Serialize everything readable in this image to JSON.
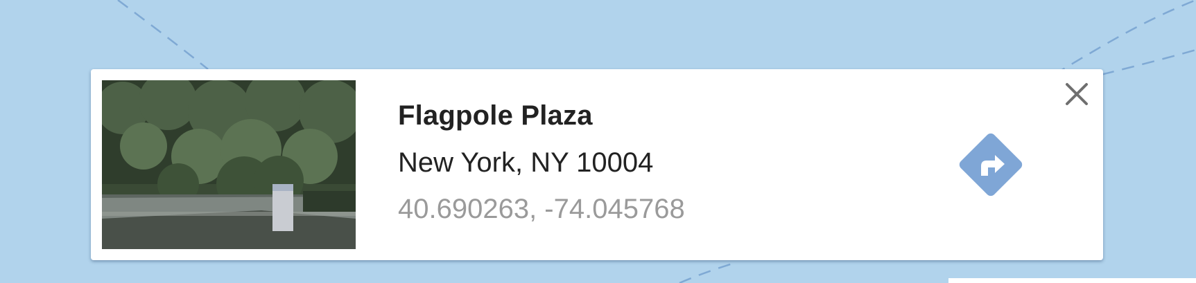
{
  "place": {
    "name": "Flagpole Plaza",
    "address": "New York, NY 10004",
    "coordinates": "40.690263, -74.045768"
  },
  "icons": {
    "close": "close-icon",
    "directions": "directions-arrow-icon"
  },
  "colors": {
    "water": "#b1d3ec",
    "directions_accent": "#7fa6d6",
    "coordinates_text": "#9a9a9a",
    "primary_text": "#222222"
  }
}
